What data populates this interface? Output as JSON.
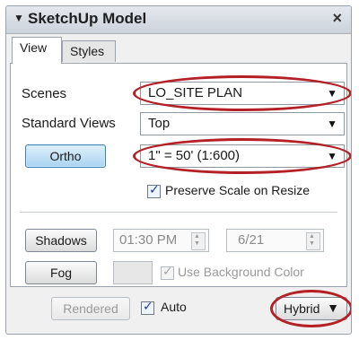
{
  "window": {
    "title": "SketchUp Model",
    "collapse_icon": "triangle-down-icon",
    "close_icon": "close-icon",
    "close_glyph": "×"
  },
  "tabs": [
    {
      "label": "View",
      "active": true
    },
    {
      "label": "Styles",
      "active": false
    }
  ],
  "view": {
    "scenes_label": "Scenes",
    "scenes_value": "LO_SITE PLAN",
    "standard_views_label": "Standard Views",
    "standard_views_value": "Top",
    "ortho_label": "Ortho",
    "scale_value": "1\" = 50' (1:600)",
    "preserve_scale_label": "Preserve Scale on Resize",
    "preserve_scale_checked": true,
    "shadows_label": "Shadows",
    "shadow_time": "01:30 PM",
    "shadow_date": "6/21",
    "fog_label": "Fog",
    "use_background_color_label": "Use Background Color",
    "use_background_color_checked": true
  },
  "footer": {
    "rendered_label": "Rendered",
    "auto_label": "Auto",
    "auto_checked": true,
    "render_mode_value": "Hybrid"
  },
  "colors": {
    "annotation_oval": "#b32025",
    "ortho_button": "#a9d3f2"
  }
}
